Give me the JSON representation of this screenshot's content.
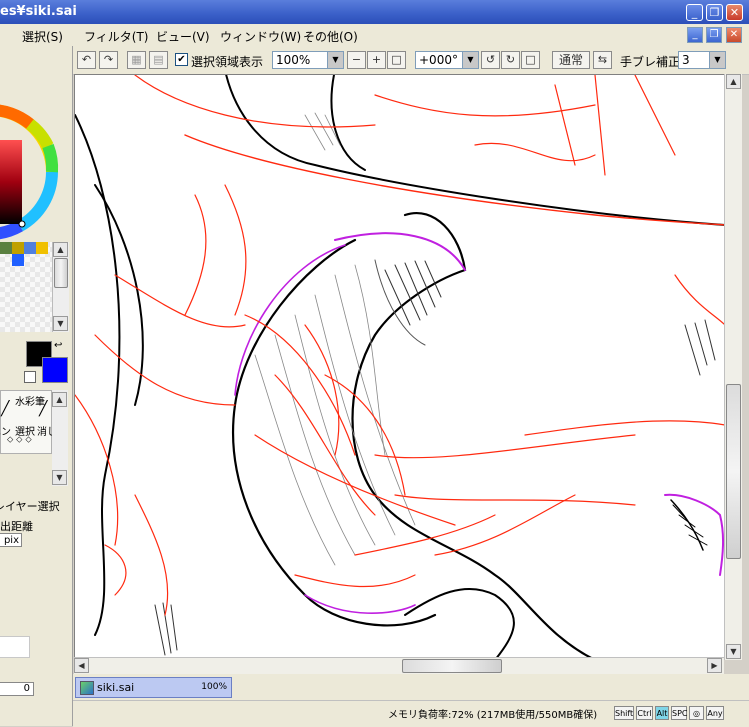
{
  "window": {
    "title": "es¥siki.sai"
  },
  "title_buttons": [
    "_",
    "❐",
    "✕"
  ],
  "menu": {
    "items": [
      "選択(S)",
      "フィルタ(T)",
      "ビュー(V)",
      "ウィンドウ(W)",
      "その他(O)"
    ]
  },
  "mdi_buttons": [
    "_",
    "❐",
    "✕"
  ],
  "toolbar": {
    "select_area_label": "選択領域表示",
    "select_area_checked": true,
    "zoom_value": "100%",
    "zoom_minus": "−",
    "zoom_plus": "+",
    "rotation_value": "+000°",
    "blend_mode": "通常",
    "stabilizer_label": "手ブレ補正",
    "stabilizer_value": "3"
  },
  "left_panel": {
    "tool_labels": [
      "水彩筆",
      "ペン",
      "選択",
      "消し"
    ],
    "layer_select_label": "レイヤー選択",
    "distance_label": "出距離",
    "distance_unit": "pix",
    "bottom_value": "0"
  },
  "file_tab": {
    "name": "siki.sai",
    "zoom": "100%"
  },
  "status": {
    "memory_text": "メモリ負荷率:72% (217MB使用/550MB確保)",
    "keys": [
      {
        "label": "Shift",
        "active": false
      },
      {
        "label": "Ctrl",
        "active": false
      },
      {
        "label": "Alt",
        "active": true
      },
      {
        "label": "SPC",
        "active": false
      },
      {
        "label": "◎",
        "active": false
      },
      {
        "label": "Any",
        "active": false
      }
    ]
  },
  "colors": {
    "primary": "#000000",
    "secondary": "#0000ff",
    "sketch_red": "#ff2a10",
    "lineart_purple": "#c020e0"
  }
}
